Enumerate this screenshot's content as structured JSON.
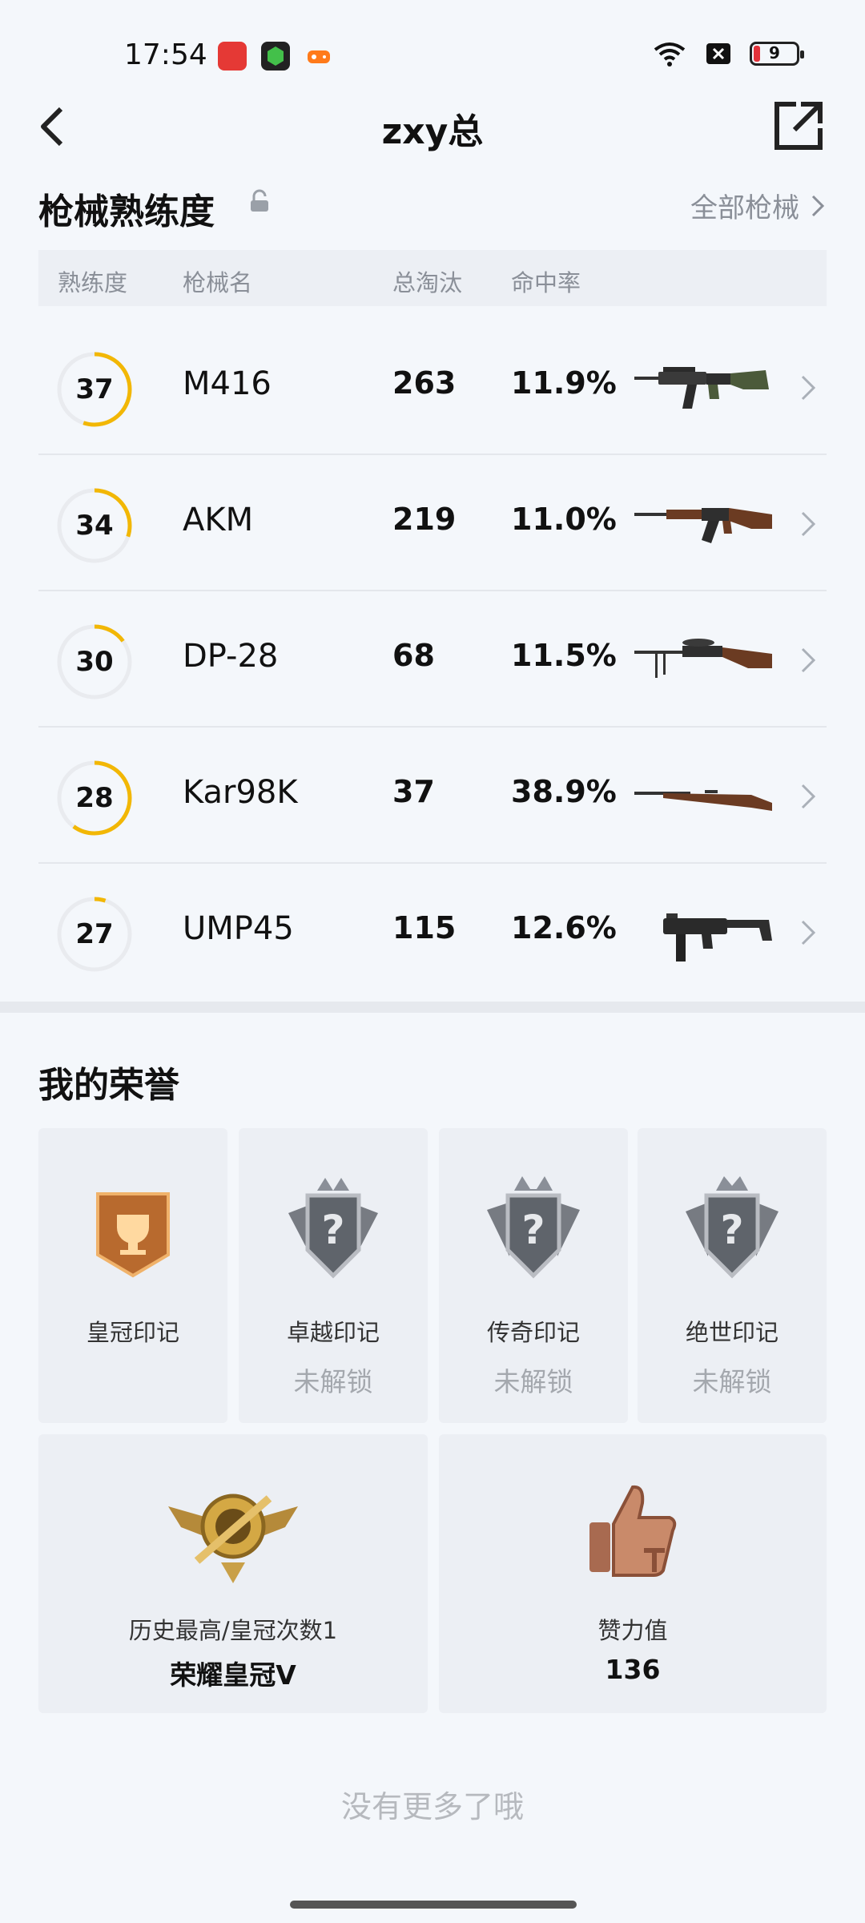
{
  "status": {
    "time": "17:54",
    "battery": "9"
  },
  "header": {
    "title": "zxy总"
  },
  "mastery": {
    "title": "枪械熟练度",
    "all_link": "全部枪械",
    "columns": [
      "熟练度",
      "枪械名",
      "总淘汰",
      "命中率"
    ],
    "rows": [
      {
        "level": "37",
        "name": "M416",
        "eliminations": "263",
        "accuracy": "11.9%",
        "ring_fraction": 0.55
      },
      {
        "level": "34",
        "name": "AKM",
        "eliminations": "219",
        "accuracy": "11.0%",
        "ring_fraction": 0.3
      },
      {
        "level": "30",
        "name": "DP-28",
        "eliminations": "68",
        "accuracy": "11.5%",
        "ring_fraction": 0.15
      },
      {
        "level": "28",
        "name": "Kar98K",
        "eliminations": "37",
        "accuracy": "38.9%",
        "ring_fraction": 0.6
      },
      {
        "level": "27",
        "name": "UMP45",
        "eliminations": "115",
        "accuracy": "12.6%",
        "ring_fraction": 0.05
      }
    ]
  },
  "honors": {
    "title": "我的荣誉",
    "badges": [
      {
        "label": "皇冠印记",
        "status": ""
      },
      {
        "label": "卓越印记",
        "status": "未解锁"
      },
      {
        "label": "传奇印记",
        "status": "未解锁"
      },
      {
        "label": "绝世印记",
        "status": "未解锁"
      }
    ],
    "highest": {
      "label": "历史最高/皇冠次数1",
      "value": "荣耀皇冠V"
    },
    "likes": {
      "label": "赞力值",
      "value": "136"
    }
  },
  "footer": {
    "text": "没有更多了哦"
  },
  "colors": {
    "ring_accent": "#f2b705",
    "ring_track": "#e9ebef"
  }
}
